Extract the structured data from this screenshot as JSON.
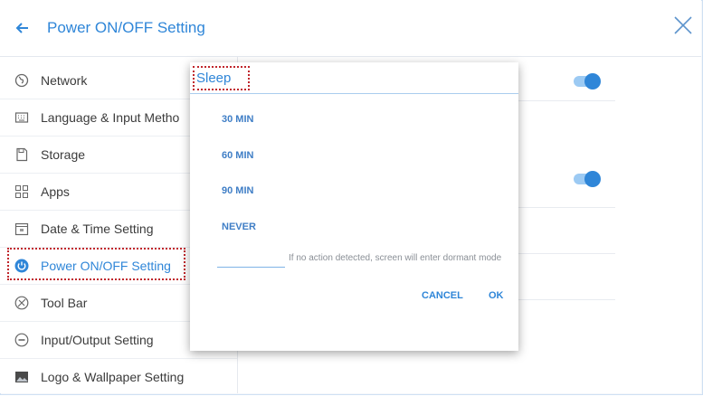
{
  "header": {
    "title": "Power ON/OFF Setting"
  },
  "sidebar": {
    "items": [
      {
        "label": "Network",
        "icon": "globe-icon"
      },
      {
        "label": "Language & Input Metho",
        "icon": "keyboard-icon"
      },
      {
        "label": "Storage",
        "icon": "storage-icon"
      },
      {
        "label": "Apps",
        "icon": "apps-grid-icon"
      },
      {
        "label": "Date & Time Setting",
        "icon": "calendar-icon"
      },
      {
        "label": "Power ON/OFF Setting",
        "icon": "power-icon",
        "active": true
      },
      {
        "label": "Tool Bar",
        "icon": "toolbar-icon"
      },
      {
        "label": "Input/Output Setting",
        "icon": "input-output-icon"
      },
      {
        "label": "Logo & Wallpaper Setting",
        "icon": "image-icon"
      }
    ]
  },
  "dialog": {
    "title": "Sleep",
    "options": [
      "30 MIN",
      "60 MIN",
      "90 MIN",
      "NEVER"
    ],
    "hint": "If no action detected, screen will enter dormant mode",
    "cancel_label": "CANCEL",
    "ok_label": "OK"
  },
  "colors": {
    "accent": "#2f86d8",
    "highlight": "#c0262c"
  }
}
